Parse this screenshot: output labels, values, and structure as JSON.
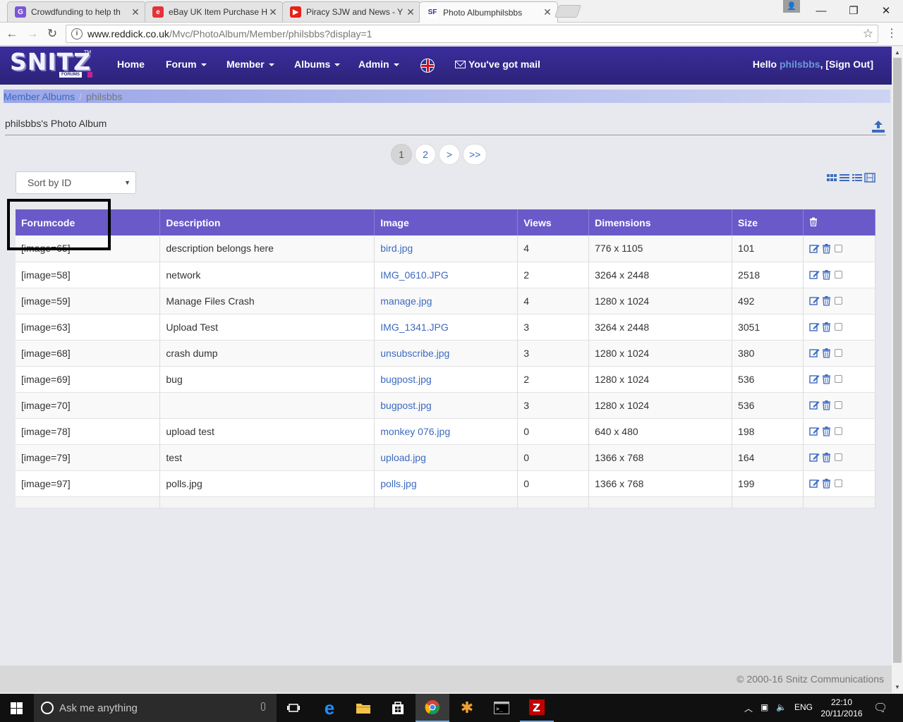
{
  "browser": {
    "tabs": [
      {
        "label": "Crowdfunding to help th",
        "favicon": "G",
        "color": "#7b57d6"
      },
      {
        "label": "eBay UK Item Purchase H",
        "favicon": "e",
        "color": "#e53238"
      },
      {
        "label": "Piracy SJW and News - Y",
        "favicon": "▶",
        "color": "#e62117"
      },
      {
        "label": "Photo Albumphilsbbs",
        "favicon": "SF",
        "color": "#3b2d9c"
      }
    ],
    "url_host": "www.reddick.co.uk",
    "url_path": "/Mvc/PhotoAlbum/Member/philsbbs?display=1"
  },
  "nav": {
    "logo": "SNITZ",
    "logo_sub": "FORUMS",
    "logo_tm": "TM",
    "home": "Home",
    "forum": "Forum",
    "member": "Member",
    "albums": "Albums",
    "admin": "Admin",
    "mail": "You've got mail",
    "hello": "Hello",
    "username": "philsbbs",
    "signout": ", [Sign Out]"
  },
  "breadcrumb": {
    "root": "Member Albums",
    "sep": "/",
    "current": "philsbbs"
  },
  "album_title": "philsbbs's Photo Album",
  "pager": {
    "pages": [
      "1",
      "2"
    ],
    "next": ">",
    "last": ">>"
  },
  "sort": {
    "selected": "Sort by ID"
  },
  "table": {
    "headers": {
      "forumcode": "Forumcode",
      "description": "Description",
      "image": "Image",
      "views": "Views",
      "dimensions": "Dimensions",
      "size": "Size"
    },
    "rows": [
      {
        "code": "[image=65]",
        "desc": "description belongs here",
        "img": "bird.jpg",
        "views": "4",
        "dim": "776 x 1105",
        "size": "101"
      },
      {
        "code": "[image=58]",
        "desc": "network",
        "img": "IMG_0610.JPG",
        "views": "2",
        "dim": "3264 x 2448",
        "size": "2518"
      },
      {
        "code": "[image=59]",
        "desc": "Manage Files Crash",
        "img": "manage.jpg",
        "views": "4",
        "dim": "1280 x 1024",
        "size": "492"
      },
      {
        "code": "[image=63]",
        "desc": "Upload Test",
        "img": "IMG_1341.JPG",
        "views": "3",
        "dim": "3264 x 2448",
        "size": "3051"
      },
      {
        "code": "[image=68]",
        "desc": "crash dump",
        "img": "unsubscribe.jpg",
        "views": "3",
        "dim": "1280 x 1024",
        "size": "380"
      },
      {
        "code": "[image=69]",
        "desc": "bug",
        "img": "bugpost.jpg",
        "views": "2",
        "dim": "1280 x 1024",
        "size": "536"
      },
      {
        "code": "[image=70]",
        "desc": "",
        "img": "bugpost.jpg",
        "views": "3",
        "dim": "1280 x 1024",
        "size": "536"
      },
      {
        "code": "[image=78]",
        "desc": "upload test",
        "img": "monkey 076.jpg",
        "views": "0",
        "dim": "640 x 480",
        "size": "198"
      },
      {
        "code": "[image=79]",
        "desc": "test",
        "img": "upload.jpg",
        "views": "0",
        "dim": "1366 x 768",
        "size": "164"
      },
      {
        "code": "[image=97]",
        "desc": "polls.jpg",
        "img": "polls.jpg",
        "views": "0",
        "dim": "1366 x 768",
        "size": "199"
      }
    ]
  },
  "footer": {
    "copyright": "© 2000-16 Snitz Communications"
  },
  "taskbar": {
    "search_placeholder": "Ask me anything",
    "lang": "ENG",
    "time": "22:10",
    "date": "20/11/2016"
  },
  "colors": {
    "navbar": "#3b2d9c",
    "table_header": "#6a59c8",
    "link": "#3c6ac0"
  }
}
